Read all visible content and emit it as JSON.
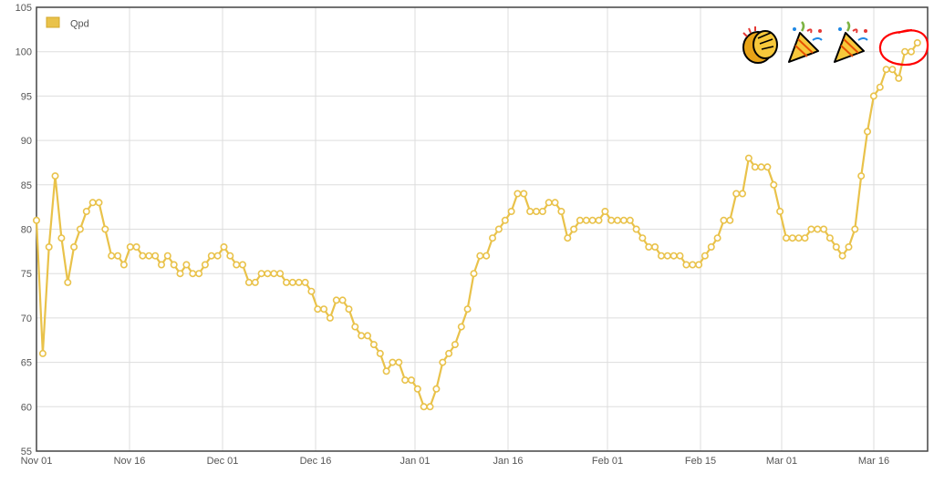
{
  "chart_data": {
    "type": "line",
    "series": [
      {
        "name": "Qpd",
        "color": "#e9c24a",
        "values": [
          81,
          66,
          78,
          86,
          79,
          74,
          78,
          80,
          82,
          83,
          83,
          80,
          77,
          77,
          76,
          78,
          78,
          77,
          77,
          77,
          76,
          77,
          76,
          75,
          76,
          75,
          75,
          76,
          77,
          77,
          78,
          77,
          76,
          76,
          74,
          74,
          75,
          75,
          75,
          75,
          74,
          74,
          74,
          74,
          73,
          71,
          71,
          70,
          72,
          72,
          71,
          69,
          68,
          68,
          67,
          66,
          64,
          65,
          65,
          63,
          63,
          62,
          60,
          60,
          62,
          65,
          66,
          67,
          69,
          71,
          75,
          77,
          77,
          79,
          80,
          81,
          82,
          84,
          84,
          82,
          82,
          82,
          83,
          83,
          82,
          79,
          80,
          81,
          81,
          81,
          81,
          82,
          81,
          81,
          81,
          81,
          80,
          79,
          78,
          78,
          77,
          77,
          77,
          77,
          76,
          76,
          76,
          77,
          78,
          79,
          81,
          81,
          84,
          84,
          88,
          87,
          87,
          87,
          85,
          82,
          79,
          79,
          79,
          79,
          80,
          80,
          80,
          79,
          78,
          77,
          78,
          80,
          86,
          91,
          95,
          96,
          98,
          98,
          97,
          100,
          100,
          101
        ]
      }
    ],
    "xlim": [
      "Nov 01",
      "Mar 22"
    ],
    "x_ticks": [
      "Nov 01",
      "Nov 16",
      "Dec 01",
      "Dec 16",
      "Jan 01",
      "Jan 16",
      "Feb 01",
      "Feb 15",
      "Mar 01",
      "Mar 16"
    ],
    "y_ticks": [
      "55",
      "60",
      "65",
      "70",
      "75",
      "80",
      "85",
      "90",
      "95",
      "100",
      "105"
    ],
    "ylim": [
      55,
      105
    ],
    "grid": true,
    "legend": "top-left",
    "annotations": {
      "emojis": [
        "clapping-hands",
        "party-popper",
        "party-popper"
      ],
      "circle_color": "#ff0000"
    }
  }
}
